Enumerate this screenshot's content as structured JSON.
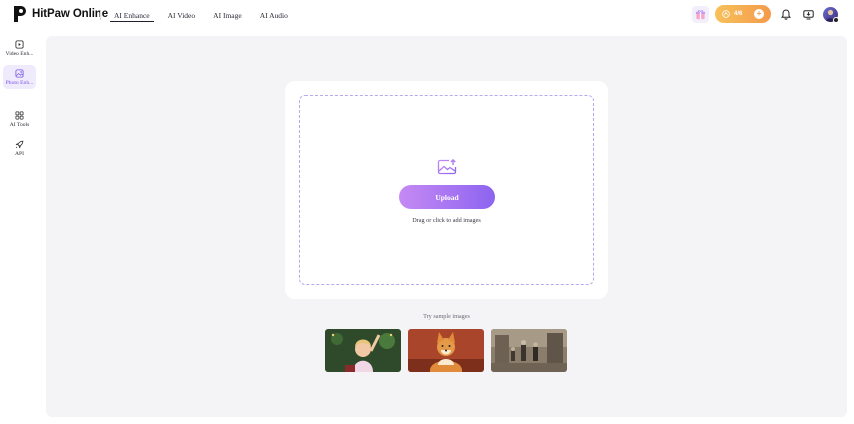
{
  "header": {
    "brand": "HitPaw Online",
    "nav": [
      {
        "label": "AI Enhance",
        "active": true
      },
      {
        "label": "AI Video",
        "active": false
      },
      {
        "label": "AI Image",
        "active": false
      },
      {
        "label": "AI Audio",
        "active": false
      }
    ],
    "credits": "4/6",
    "icons": [
      "gift-icon",
      "coin-icon",
      "plus-icon",
      "bell-icon",
      "download-icon",
      "avatar"
    ]
  },
  "sidebar": {
    "items": [
      {
        "label": "Video Enh...",
        "icon": "video-enhance-icon",
        "active": false
      },
      {
        "label": "Photo Enh...",
        "icon": "photo-enhance-icon",
        "active": true
      },
      {
        "label": "AI Tools",
        "icon": "grid-icon",
        "active": false
      },
      {
        "label": "API",
        "icon": "rocket-icon",
        "active": false
      }
    ]
  },
  "upload": {
    "button_label": "Upload",
    "hint": "Drag or click to add images"
  },
  "samples": {
    "label": "Try sample images",
    "items": [
      {
        "name": "sample-girl"
      },
      {
        "name": "sample-dog"
      },
      {
        "name": "sample-old-photo"
      }
    ]
  },
  "colors": {
    "accent": "#8d64f0",
    "accent_light": "#c58af3",
    "credits": "#f49a4b",
    "canvas_bg": "#f4f4f6"
  }
}
